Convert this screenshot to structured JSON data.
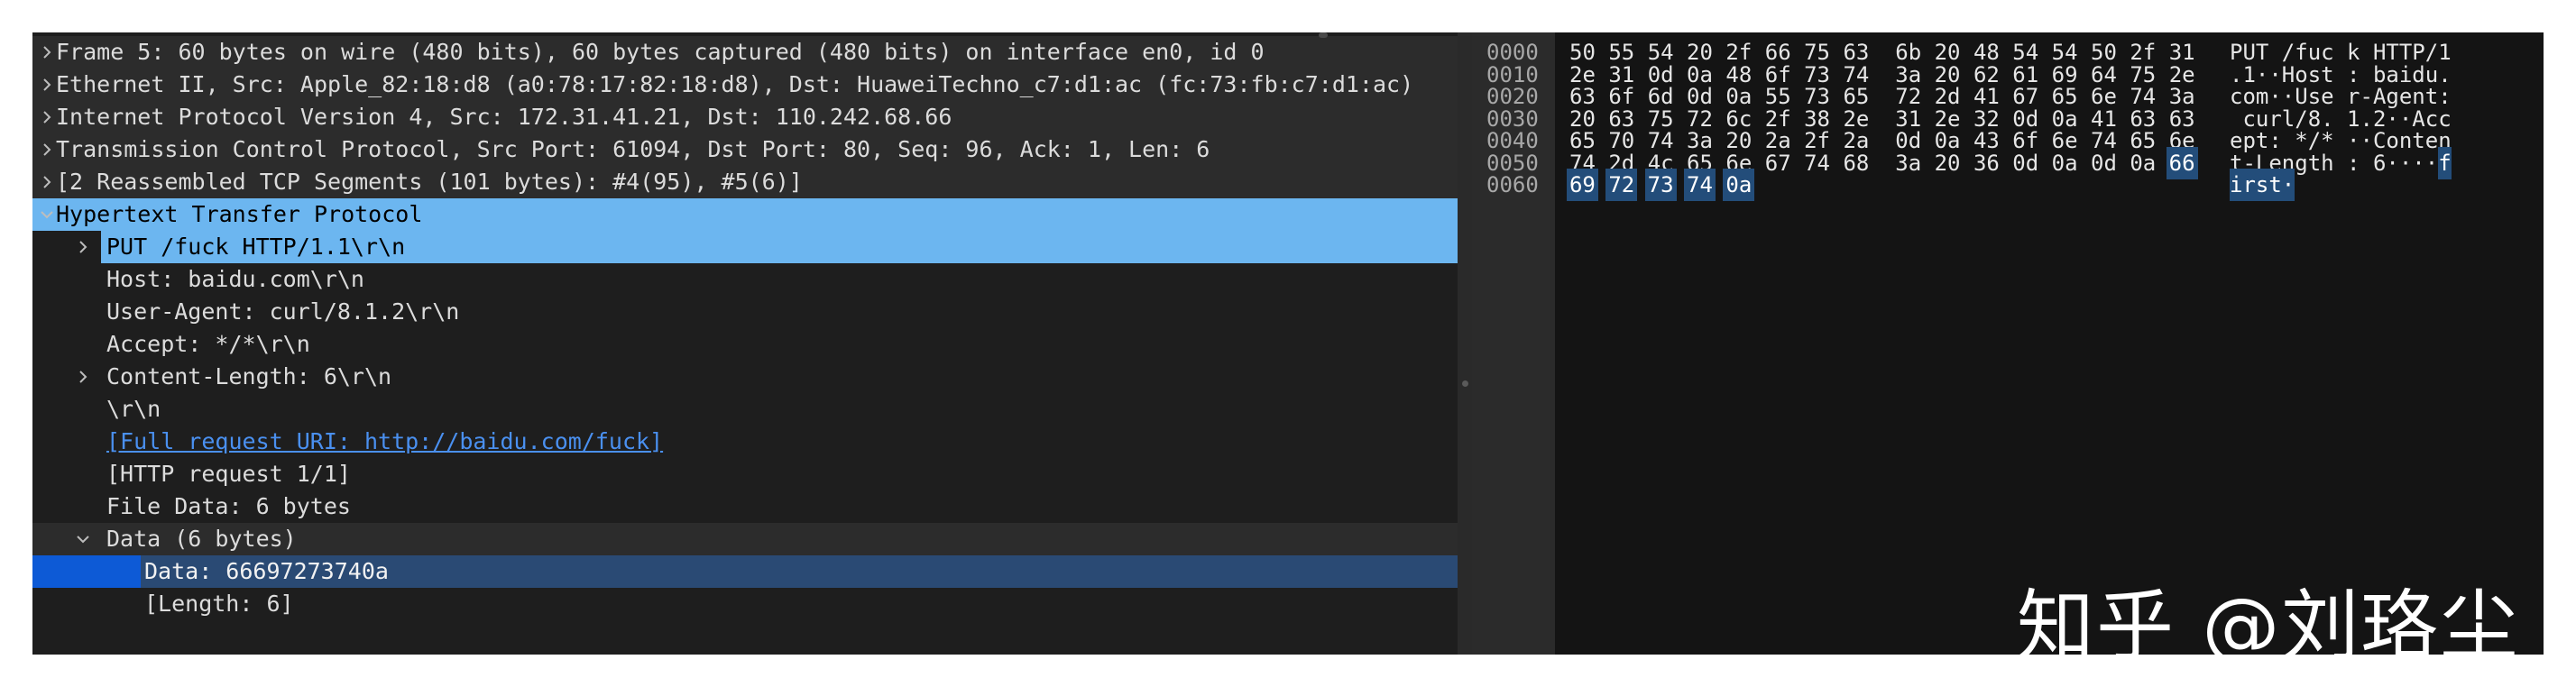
{
  "tree": [
    {
      "label": "Frame 5: 60 bytes on wire (480 bits), 60 bytes captured (480 bits) on interface en0, id 0",
      "indent": 0,
      "arrow": "right",
      "style": "dark"
    },
    {
      "label": "Ethernet II, Src: Apple_82:18:d8 (a0:78:17:82:18:d8), Dst: HuaweiTechno_c7:d1:ac (fc:73:fb:c7:d1:ac)",
      "indent": 0,
      "arrow": "right",
      "style": "dark"
    },
    {
      "label": "Internet Protocol Version 4, Src: 172.31.41.21, Dst: 110.242.68.66",
      "indent": 0,
      "arrow": "right",
      "style": "dark"
    },
    {
      "label": "Transmission Control Protocol, Src Port: 61094, Dst Port: 80, Seq: 96, Ack: 1, Len: 6",
      "indent": 0,
      "arrow": "right",
      "style": "dark"
    },
    {
      "label": "[2 Reassembled TCP Segments (101 bytes): #4(95), #5(6)]",
      "indent": 0,
      "arrow": "right",
      "style": "dark"
    },
    {
      "label": "Hypertext Transfer Protocol",
      "indent": 0,
      "arrow": "down",
      "style": "hl"
    },
    {
      "label": "PUT /fuck HTTP/1.1\\r\\n",
      "indent": 1,
      "arrow": "right",
      "style": "hl"
    },
    {
      "label": "Host: baidu.com\\r\\n",
      "indent": 1,
      "arrow": "",
      "style": ""
    },
    {
      "label": "User-Agent: curl/8.1.2\\r\\n",
      "indent": 1,
      "arrow": "",
      "style": ""
    },
    {
      "label": "Accept: */*\\r\\n",
      "indent": 1,
      "arrow": "",
      "style": ""
    },
    {
      "label": "Content-Length: 6\\r\\n",
      "indent": 1,
      "arrow": "right",
      "style": ""
    },
    {
      "label": "\\r\\n",
      "indent": 1,
      "arrow": "",
      "style": ""
    },
    {
      "label": "[Full request URI: http://baidu.com/fuck]",
      "indent": 1,
      "arrow": "",
      "style": "link"
    },
    {
      "label": "[HTTP request 1/1]",
      "indent": 1,
      "arrow": "",
      "style": ""
    },
    {
      "label": "File Data: 6 bytes",
      "indent": 1,
      "arrow": "",
      "style": ""
    },
    {
      "label": "Data (6 bytes)",
      "indent": 1,
      "arrow": "down",
      "style": "dark"
    },
    {
      "label": "Data: 66697273740a",
      "indent": 2,
      "arrow": "",
      "style": "selected"
    },
    {
      "label": "[Length: 6]",
      "indent": 2,
      "arrow": "",
      "style": ""
    }
  ],
  "hex": {
    "offsets": [
      "0000",
      "0010",
      "0020",
      "0030",
      "0040",
      "0050",
      "0060"
    ],
    "rows": [
      [
        "50",
        "55",
        "54",
        "20",
        "2f",
        "66",
        "75",
        "63",
        "6b",
        "20",
        "48",
        "54",
        "54",
        "50",
        "2f",
        "31"
      ],
      [
        "2e",
        "31",
        "0d",
        "0a",
        "48",
        "6f",
        "73",
        "74",
        "3a",
        "20",
        "62",
        "61",
        "69",
        "64",
        "75",
        "2e"
      ],
      [
        "63",
        "6f",
        "6d",
        "0d",
        "0a",
        "55",
        "73",
        "65",
        "72",
        "2d",
        "41",
        "67",
        "65",
        "6e",
        "74",
        "3a"
      ],
      [
        "20",
        "63",
        "75",
        "72",
        "6c",
        "2f",
        "38",
        "2e",
        "31",
        "2e",
        "32",
        "0d",
        "0a",
        "41",
        "63",
        "63"
      ],
      [
        "65",
        "70",
        "74",
        "3a",
        "20",
        "2a",
        "2f",
        "2a",
        "0d",
        "0a",
        "43",
        "6f",
        "6e",
        "74",
        "65",
        "6e"
      ],
      [
        "74",
        "2d",
        "4c",
        "65",
        "6e",
        "67",
        "74",
        "68",
        "3a",
        "20",
        "36",
        "0d",
        "0a",
        "0d",
        "0a",
        "66"
      ],
      [
        "69",
        "72",
        "73",
        "74",
        "0a"
      ]
    ],
    "ascii": [
      "PUT /fuck HTTP/1",
      ".1··Host: baidu.",
      "com··User-Agent:",
      " curl/8.1.2··Acc",
      "ept: */*··Conten",
      "t-Length: 6····f",
      "irst·"
    ],
    "highlight": {
      "row": 5,
      "from": 15
    }
  },
  "watermark": "知乎 @刘珞尘",
  "colors": {
    "background": "#1e1e1e",
    "selection": "#0d5ad6",
    "field_highlight": "#6cb6f0",
    "byte_highlight": "#234d7a",
    "link": "#4a90f0"
  }
}
